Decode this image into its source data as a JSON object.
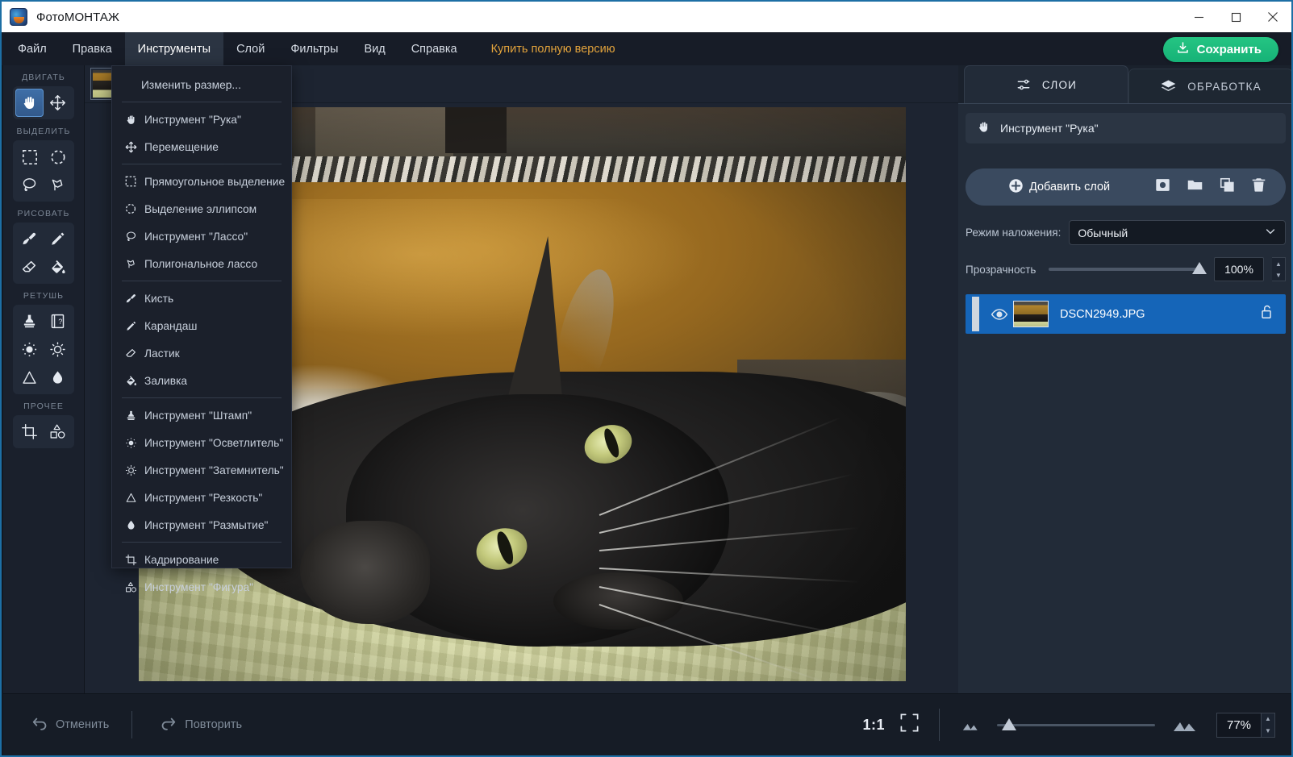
{
  "window": {
    "title": "ФотоМОНТАЖ",
    "app_icon": "photomontage-logo-icon",
    "minimize": "minimize-icon",
    "maximize": "maximize-icon",
    "close": "close-icon"
  },
  "menubar": {
    "items": [
      {
        "label": "Файл",
        "active": false
      },
      {
        "label": "Правка",
        "active": false
      },
      {
        "label": "Инструменты",
        "active": true
      },
      {
        "label": "Слой",
        "active": false
      },
      {
        "label": "Фильтры",
        "active": false
      },
      {
        "label": "Вид",
        "active": false
      },
      {
        "label": "Справка",
        "active": false
      }
    ],
    "buy_label": "Купить полную версию",
    "save_label": "Сохранить",
    "accent_green": "#1bb97c",
    "accent_gold": "#e2a33c"
  },
  "dropdown": {
    "open_for": "Инструменты",
    "items": [
      {
        "label": "Изменить размер...",
        "icon": ""
      },
      {
        "sep": true
      },
      {
        "label": "Инструмент \"Рука\"",
        "icon": "hand-icon"
      },
      {
        "label": "Перемещение",
        "icon": "move-icon"
      },
      {
        "sep": true
      },
      {
        "label": "Прямоугольное выделение",
        "icon": "rect-select-icon"
      },
      {
        "label": "Выделение эллипсом",
        "icon": "ellipse-select-icon"
      },
      {
        "label": "Инструмент \"Лассо\"",
        "icon": "lasso-icon"
      },
      {
        "label": "Полигональное лассо",
        "icon": "polygon-lasso-icon"
      },
      {
        "sep": true
      },
      {
        "label": "Кисть",
        "icon": "brush-icon"
      },
      {
        "label": "Карандаш",
        "icon": "pencil-icon"
      },
      {
        "label": "Ластик",
        "icon": "eraser-icon"
      },
      {
        "label": "Заливка",
        "icon": "fill-bucket-icon"
      },
      {
        "sep": true
      },
      {
        "label": "Инструмент \"Штамп\"",
        "icon": "stamp-icon"
      },
      {
        "label": "Инструмент \"Осветлитель\"",
        "icon": "dodge-icon"
      },
      {
        "label": "Инструмент \"Затемнитель\"",
        "icon": "burn-icon"
      },
      {
        "label": "Инструмент \"Резкость\"",
        "icon": "sharpen-icon"
      },
      {
        "label": "Инструмент \"Размытие\"",
        "icon": "blur-icon"
      },
      {
        "sep": true
      },
      {
        "label": "Кадрирование",
        "icon": "crop-icon"
      },
      {
        "label": "Инструмент \"Фигура\"",
        "icon": "shape-icon"
      }
    ]
  },
  "left_toolbar": {
    "sections": [
      {
        "label": "ДВИГАТЬ",
        "tools": [
          {
            "name": "hand-tool",
            "icon": "hand-icon",
            "selected": true
          },
          {
            "name": "move-tool",
            "icon": "move-icon",
            "selected": false
          }
        ]
      },
      {
        "label": "ВЫДЕЛИТЬ",
        "tools": [
          {
            "name": "rect-select-tool",
            "icon": "rect-select-icon",
            "selected": false
          },
          {
            "name": "ellipse-select-tool",
            "icon": "ellipse-select-icon",
            "selected": false
          },
          {
            "name": "lasso-tool",
            "icon": "lasso-icon",
            "selected": false
          },
          {
            "name": "polygon-lasso-tool",
            "icon": "polygon-lasso-icon",
            "selected": false
          }
        ]
      },
      {
        "label": "РИСОВАТЬ",
        "tools": [
          {
            "name": "brush-tool",
            "icon": "brush-icon",
            "selected": false
          },
          {
            "name": "pencil-tool",
            "icon": "pencil-icon",
            "selected": false
          },
          {
            "name": "eraser-tool",
            "icon": "eraser-icon",
            "selected": false
          },
          {
            "name": "fill-tool",
            "icon": "fill-bucket-icon",
            "selected": false
          }
        ]
      },
      {
        "label": "РЕТУШЬ",
        "tools": [
          {
            "name": "stamp-tool",
            "icon": "stamp-icon",
            "selected": false
          },
          {
            "name": "patch-tool",
            "icon": "patch-icon",
            "selected": false
          },
          {
            "name": "dodge-tool",
            "icon": "dodge-icon",
            "selected": false
          },
          {
            "name": "burn-tool",
            "icon": "burn-icon",
            "selected": false
          },
          {
            "name": "sharpen-tool",
            "icon": "sharpen-icon",
            "selected": false
          },
          {
            "name": "blur-tool",
            "icon": "blur-icon",
            "selected": false
          }
        ]
      },
      {
        "label": "ПРОЧЕЕ",
        "tools": [
          {
            "name": "crop-tool",
            "icon": "crop-icon",
            "selected": false
          },
          {
            "name": "shape-tool",
            "icon": "shape-icon",
            "selected": false
          }
        ]
      }
    ]
  },
  "canvas": {
    "document_tab_thumbnail": "cat-photo-thumbnail",
    "photo_description": "Чёрный кот лежит на светло-зелёном пледе у коричневого дивана"
  },
  "right_panel": {
    "tabs": [
      {
        "label": "СЛОИ",
        "icon": "sliders-icon",
        "selected": true
      },
      {
        "label": "ОБРАБОТКА",
        "icon": "layers-stack-icon",
        "selected": false
      }
    ],
    "active_tool_label": "Инструмент \"Рука\"",
    "active_tool_icon": "hand-icon",
    "add_layer_label": "Добавить слой",
    "layer_action_icons": [
      "mask-icon",
      "folder-icon",
      "duplicate-icon",
      "trash-icon"
    ],
    "blend_mode_label": "Режим наложения:",
    "blend_mode_value": "Обычный",
    "opacity_label": "Прозрачность",
    "opacity_value": "100%",
    "opacity_percent": 100,
    "layers": [
      {
        "name": "DSCN2949.JPG",
        "visible": true,
        "locked": false,
        "selected": true,
        "eye_icon": "eye-icon",
        "lock_icon": "unlock-icon",
        "selected_color": "#1565b8"
      }
    ]
  },
  "statusbar": {
    "undo_label": "Отменить",
    "undo_icon": "undo-arrow-icon",
    "redo_label": "Повторить",
    "redo_icon": "redo-arrow-icon",
    "ratio_label": "1:1",
    "fit_icon": "fit-to-screen-icon",
    "zoom_out_icon": "small-mountains-icon",
    "zoom_in_icon": "large-mountains-icon",
    "zoom_value": "77%",
    "zoom_percent": 77
  }
}
